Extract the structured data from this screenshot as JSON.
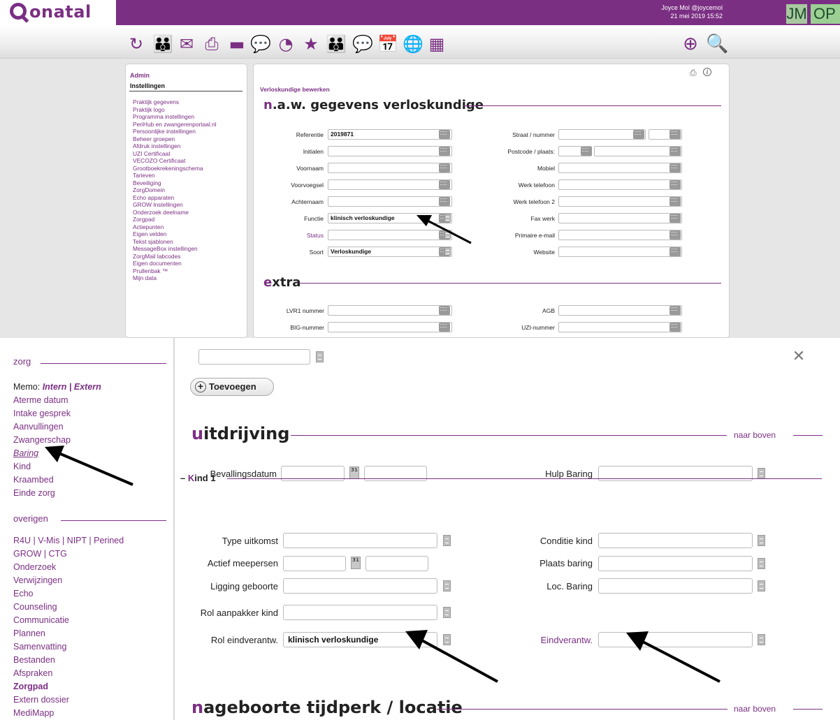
{
  "header": {
    "logo_text": "onatal",
    "user_line": "Joyce Mol @joycemol",
    "datetime": "21 mei 2019 15:52",
    "avatar_initials": "JM",
    "op_label": "OP"
  },
  "toolbar": {
    "icons": [
      "onatal-home-icon",
      "clients-icon",
      "mail-icon",
      "print-icon",
      "card-icon",
      "chat-icon",
      "statistics-icon",
      "favorites-icon",
      "team-icon",
      "messages-icon",
      "calendar-icon",
      "web-icon",
      "calculator-icon"
    ],
    "right_icons": [
      "add-icon",
      "search-icon"
    ]
  },
  "admin": {
    "title": "Admin",
    "section": "Instellingen",
    "items": [
      "Praktijk gegevens",
      "Praktijk logo",
      "Programma instellingen",
      "PeriHub en zwangerenportaal.nl",
      "Persoonlijke instellingen",
      "Beheer groepen",
      "Afdruk instellingen",
      "UZI Certificaat",
      "VECOZO Certificaat",
      "Grootboekrekeningschema",
      "Tarieven",
      "Beveiliging",
      "ZorgDomein",
      "Echo apparaten",
      "GROW Instellingen",
      "Onderzoek deelname",
      "Zorgpad",
      "Actiepunten",
      "Eigen velden",
      "Tekst sjablonen",
      "MessageBox instellingen",
      "ZorgMail labcodes",
      "Eigen documenten",
      "Prullenbak ™",
      "Mijn data"
    ]
  },
  "edit": {
    "breadcrumb": "Verloskundige bewerken",
    "naw_first": "n",
    "naw_rest": ".a.w. gegevens verloskundige",
    "extra_first": "e",
    "extra_rest": "xtra",
    "left_fields": [
      {
        "label": "Referentie",
        "value": "2019871"
      },
      {
        "label": "Initialen",
        "value": ""
      },
      {
        "label": "Voornaam",
        "value": ""
      },
      {
        "label": "Voorvoegsel",
        "value": ""
      },
      {
        "label": "Achternaam",
        "value": ""
      },
      {
        "label": "Functie",
        "value": "klinisch verloskundige"
      },
      {
        "label": "Status",
        "value": ""
      },
      {
        "label": "Soort",
        "value": "Verloskundige"
      }
    ],
    "right_fields": [
      {
        "label": "Straat / nummer",
        "value": ""
      },
      {
        "label": "Postcode / plaats:",
        "value": ""
      },
      {
        "label": "Mobiel",
        "value": ""
      },
      {
        "label": "Werk telefoon",
        "value": ""
      },
      {
        "label": "Werk telefoon 2",
        "value": ""
      },
      {
        "label": "Fax werk",
        "value": ""
      },
      {
        "label": "Primaire e-mail",
        "value": ""
      },
      {
        "label": "Website",
        "value": ""
      }
    ],
    "extra_fields": [
      {
        "label": "LVR1 nummer",
        "value": ""
      },
      {
        "label": "BIG-nummer",
        "value": ""
      },
      {
        "label": "AGB",
        "value": ""
      },
      {
        "label": "UZI-nummer",
        "value": ""
      }
    ]
  },
  "nav": {
    "zorg_head": "zorg",
    "memo_label": "Memo:",
    "memo_intern": "Intern",
    "memo_sep": "|",
    "memo_extern": "Extern",
    "zorg_items": [
      "Aterme datum",
      "Intake gesprek",
      "Aanvullingen",
      "Zwangerschap",
      "Baring",
      "Kind",
      "Kraambed",
      "Einde zorg"
    ],
    "active_item": "Baring",
    "overigen_head": "overigen",
    "r4u_line": [
      "R4U",
      "V-Mis",
      "NIPT",
      "Perined"
    ],
    "grow_line": [
      "GROW",
      "CTG"
    ],
    "overigen_items": [
      "Onderzoek",
      "Verwijzingen",
      "Echo",
      "Counseling",
      "Communicatie",
      "Plannen",
      "Samenvatting",
      "Bestanden",
      "Afspraken",
      "Zorgpad",
      "Extern dossier",
      "MediMapp"
    ],
    "bold_item": "Zorgpad"
  },
  "form": {
    "toevoegen_label": "Toevoegen",
    "uitdrijving_first": "u",
    "uitdrijving_rest": "itdrijving",
    "naar_boven": "naar boven",
    "bevallingsdatum_label": "Bevallingsdatum",
    "hulp_baring_label": "Hulp Baring",
    "kind_dash": "–",
    "kind_first": "K",
    "kind_rest": "ind 1",
    "type_uitkomst_label": "Type uitkomst",
    "actief_meepersen_label": "Actief meepersen",
    "ligging_label": "Ligging geboorte",
    "rol_aanpakker_label": "Rol aanpakker kind",
    "rol_eind_label": "Rol eindverantw.",
    "rol_eind_value": "klinisch verloskundige",
    "conditie_label": "Conditie kind",
    "plaats_label": "Plaats baring",
    "loc_label": "Loc. Baring",
    "eindverantw_label": "Eindverantw.",
    "nageboorte_first": "n",
    "nageboorte_rest": "ageboorte tijdperk / locatie",
    "calendar_day": "31"
  },
  "colors": {
    "brand_purple": "#7b2f83",
    "avatar_green": "#a8c8a0"
  }
}
